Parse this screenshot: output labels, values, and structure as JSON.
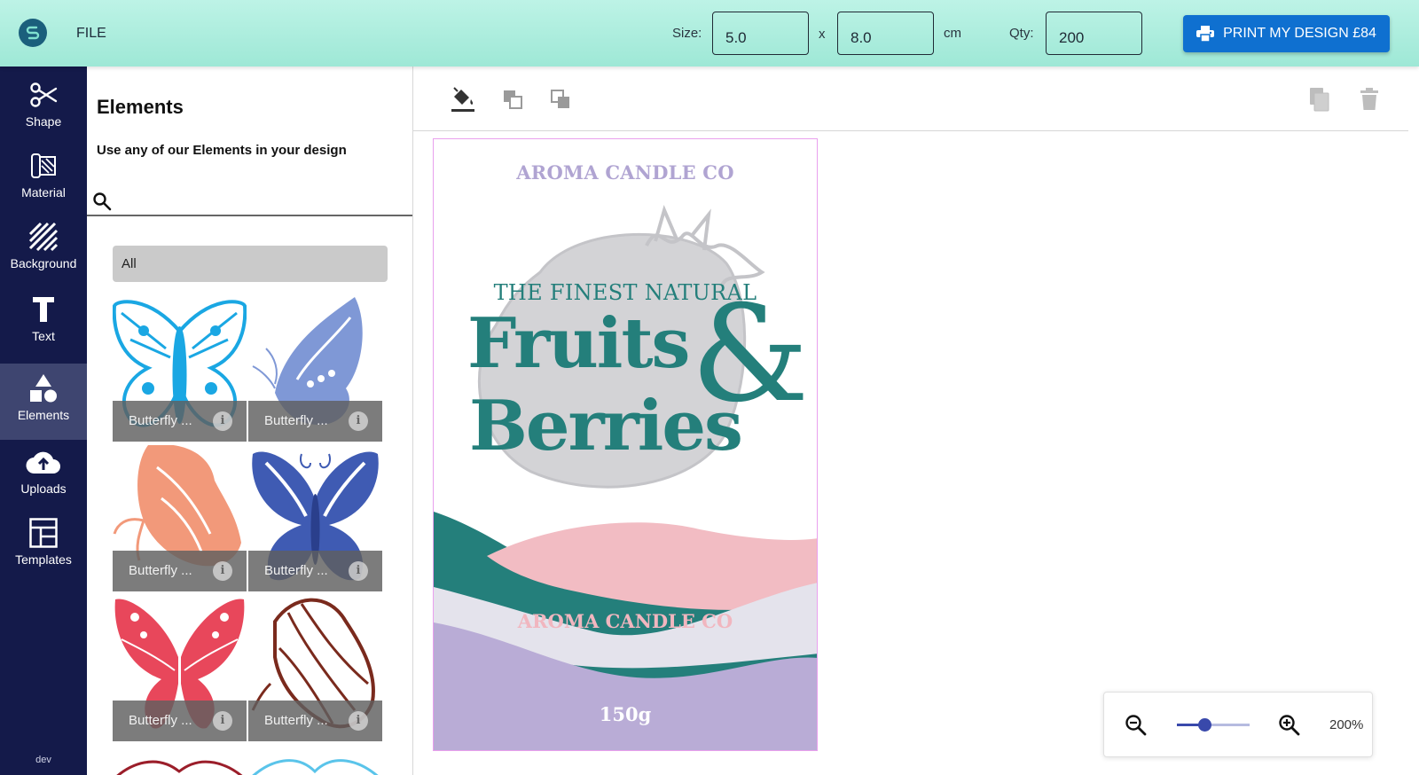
{
  "app": {
    "file_menu": "FILE"
  },
  "header": {
    "size_label": "Size:",
    "width_value": "5.0",
    "times": "x",
    "height_value": "8.0",
    "unit": "cm",
    "qty_label": "Qty:",
    "qty_value": "200",
    "print_label": "PRINT MY DESIGN £84",
    "accent": "#0f70d0"
  },
  "sidebar": {
    "items": [
      {
        "label": "Shape",
        "icon": "scissors-icon"
      },
      {
        "label": "Material",
        "icon": "material-icon"
      },
      {
        "label": "Background",
        "icon": "stripes-icon"
      },
      {
        "label": "Text",
        "icon": "text-icon"
      },
      {
        "label": "Elements",
        "icon": "shapes-icon",
        "active": true
      },
      {
        "label": "Uploads",
        "icon": "cloud-upload-icon"
      },
      {
        "label": "Templates",
        "icon": "template-icon"
      }
    ],
    "footer": "dev"
  },
  "panel": {
    "title": "Elements",
    "subtitle": "Use any of our Elements in your design",
    "search_placeholder": "",
    "filter": "All",
    "tiles": [
      {
        "caption": "Butterfly ...",
        "color": "#1aa7e3"
      },
      {
        "caption": "Butterfly ...",
        "color": "#7f98d6"
      },
      {
        "caption": "Butterfly ...",
        "color": "#f2997a"
      },
      {
        "caption": "Butterfly ...",
        "color": "#3f5bb3"
      },
      {
        "caption": "Butterfly ...",
        "color": "#e8475b"
      },
      {
        "caption": "Butterfly ...",
        "color": "#7a2a1d"
      }
    ],
    "info_glyph": "i"
  },
  "toolbar": {
    "tools": [
      "fill-bucket-icon",
      "bring-forward-icon",
      "send-backward-icon",
      "duplicate-icon",
      "delete-icon"
    ]
  },
  "design": {
    "top_brand": "AROMA CANDLE CO",
    "tagline": "THE FINEST NATURAL",
    "line1": "Fruits",
    "ampersand": "&",
    "line2": "Berries",
    "bottom_brand": "AROMA CANDLE CO",
    "weight": "150g",
    "colors": {
      "teal": "#247f7b",
      "pink": "#f2bcc3",
      "lavender": "#b9acd6",
      "grey": "#e4e3ec"
    }
  },
  "zoom": {
    "value_label": "200%",
    "level": 0.38
  }
}
